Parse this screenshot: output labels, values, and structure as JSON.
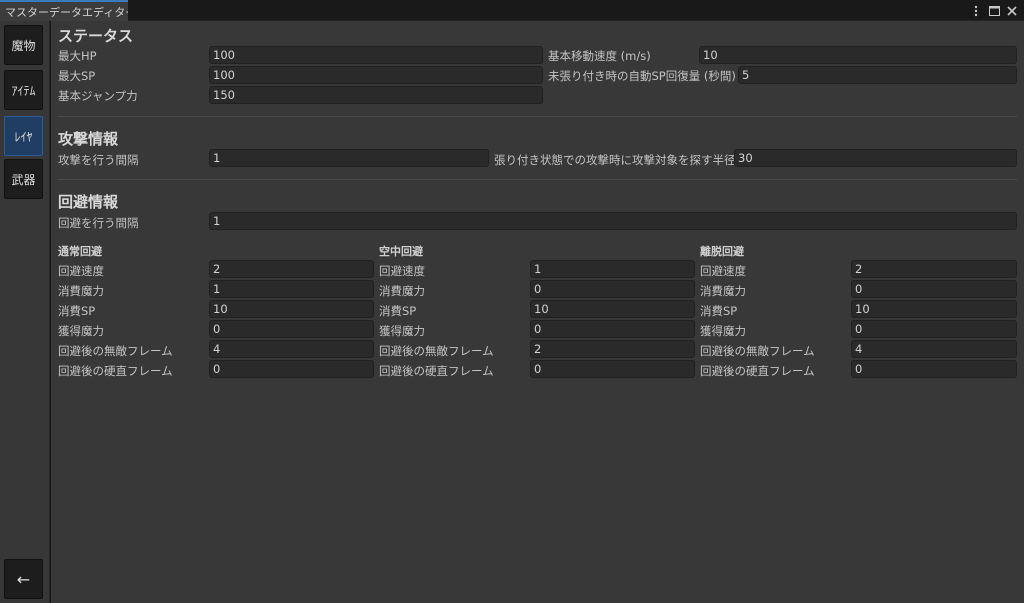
{
  "window": {
    "tab_title": "マスターデータエディター",
    "icons": [
      "more-vertical-icon",
      "maximize-icon",
      "close-icon"
    ]
  },
  "sidebar": {
    "items": [
      {
        "label": "魔物",
        "active": false
      },
      {
        "label": "ｱｲﾃﾑ",
        "active": false
      },
      {
        "label": "ﾚｲﾔ",
        "active": true
      },
      {
        "label": "武器",
        "active": false
      }
    ],
    "back_label": "←"
  },
  "status": {
    "title": "ステータス",
    "max_hp_label": "最大HP",
    "max_hp": "100",
    "max_sp_label": "最大SP",
    "max_sp": "100",
    "jump_label": "基本ジャンプ力",
    "jump": "150",
    "move_speed_label": "基本移動速度 (m/s)",
    "move_speed": "10",
    "sp_regen_label": "未張り付き時の自動SP回復量 (秒間)",
    "sp_regen": "5"
  },
  "attack": {
    "title": "攻撃情報",
    "interval_label": "攻撃を行う間隔",
    "interval": "1",
    "search_radius_label": "張り付き状態での攻撃時に攻撃対象を探す半径",
    "search_radius": "30"
  },
  "evasion": {
    "title": "回避情報",
    "interval_label": "回避を行う間隔",
    "interval": "1",
    "groups": [
      {
        "title": "通常回避",
        "rows": [
          {
            "label": "回避速度",
            "value": "2"
          },
          {
            "label": "消費魔力",
            "value": "1"
          },
          {
            "label": "消費SP",
            "value": "10"
          },
          {
            "label": "獲得魔力",
            "value": "0"
          },
          {
            "label": "回避後の無敵フレーム",
            "value": "4"
          },
          {
            "label": "回避後の硬直フレーム",
            "value": "0"
          }
        ]
      },
      {
        "title": "空中回避",
        "rows": [
          {
            "label": "回避速度",
            "value": "1"
          },
          {
            "label": "消費魔力",
            "value": "0"
          },
          {
            "label": "消費SP",
            "value": "10"
          },
          {
            "label": "獲得魔力",
            "value": "0"
          },
          {
            "label": "回避後の無敵フレーム",
            "value": "2"
          },
          {
            "label": "回避後の硬直フレーム",
            "value": "0"
          }
        ]
      },
      {
        "title": "離脱回避",
        "rows": [
          {
            "label": "回避速度",
            "value": "2"
          },
          {
            "label": "消費魔力",
            "value": "0"
          },
          {
            "label": "消費SP",
            "value": "10"
          },
          {
            "label": "獲得魔力",
            "value": "0"
          },
          {
            "label": "回避後の無敵フレーム",
            "value": "4"
          },
          {
            "label": "回避後の硬直フレーム",
            "value": "0"
          }
        ]
      }
    ]
  },
  "colors": {
    "accent": "#3a79bb",
    "active_nav": "#203e63",
    "panel": "#383838",
    "field": "#2a2a2a"
  }
}
